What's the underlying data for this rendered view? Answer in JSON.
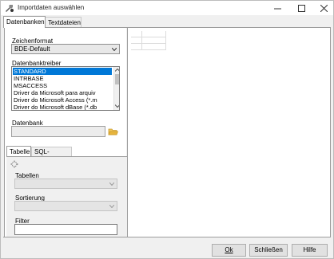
{
  "window": {
    "title": "Importdaten auswählen",
    "icons": {
      "app": "tools-icon",
      "minimize": "minimize-icon",
      "maximize": "maximize-icon",
      "close": "close-icon"
    }
  },
  "tabs": [
    {
      "label": "Datenbanken",
      "active": true
    },
    {
      "label": "Textdateien",
      "active": false
    }
  ],
  "left": {
    "zeichenformat_label": "Zeichenformat",
    "zeichenformat_value": "BDE-Default",
    "treiber_label": "Datenbanktreiber",
    "treiber_items": [
      "STANDARD",
      "INTRBASE",
      "MSACCESS",
      "Driver da Microsoft para arquiv",
      "Driver do Microsoft Access (*.m",
      "Driver do Microsoft dBase (*.db"
    ],
    "treiber_selected": 0,
    "datenbank_label": "Datenbank",
    "datenbank_value": "",
    "subtabs": [
      {
        "label": "Tabelle",
        "active": true
      },
      {
        "label": "SQL- Abfrage",
        "active": false
      }
    ],
    "tabellen_label": "Tabellen",
    "sortierung_label": "Sortierung",
    "filter_label": "Filter",
    "filter_value": ""
  },
  "buttons": {
    "ok": "Ok",
    "schliessen": "Schließen",
    "hilfe": "Hilfe"
  },
  "colors": {
    "selection": "#0078d7",
    "folder": "#e8b53c"
  }
}
